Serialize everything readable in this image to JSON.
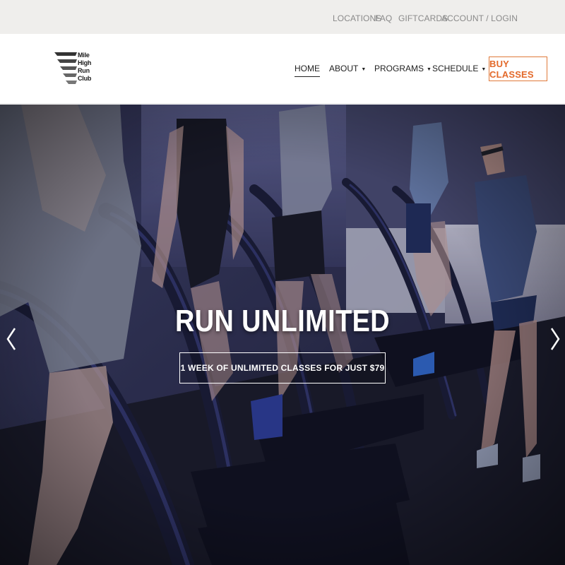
{
  "utility_nav": [
    {
      "label": "LOCATIONS"
    },
    {
      "label": "FAQ"
    },
    {
      "label": "GIFTCARDS"
    },
    {
      "label": "ACCOUNT / LOGIN"
    }
  ],
  "brand": {
    "logo_lines": [
      "Mile",
      "High",
      "Run",
      "Club"
    ]
  },
  "main_nav": [
    {
      "label": "HOME",
      "active": true
    },
    {
      "label": "ABOUT",
      "dropdown": true
    },
    {
      "label": "PROGRAMS",
      "dropdown": true
    },
    {
      "label": "SCHEDULE",
      "dropdown": true
    }
  ],
  "buy_button": {
    "label": "BUY CLASSES"
  },
  "hero": {
    "title": "RUN UNLIMITED",
    "cta": "1 WEEK OF UNLIMITED CLASSES FOR JUST $79",
    "prev_icon": "chevron-left-icon",
    "next_icon": "chevron-right-icon"
  },
  "colors": {
    "accent": "#e3692a",
    "utility_bg": "#efeeec",
    "hero_tint": "#2a2c48"
  }
}
